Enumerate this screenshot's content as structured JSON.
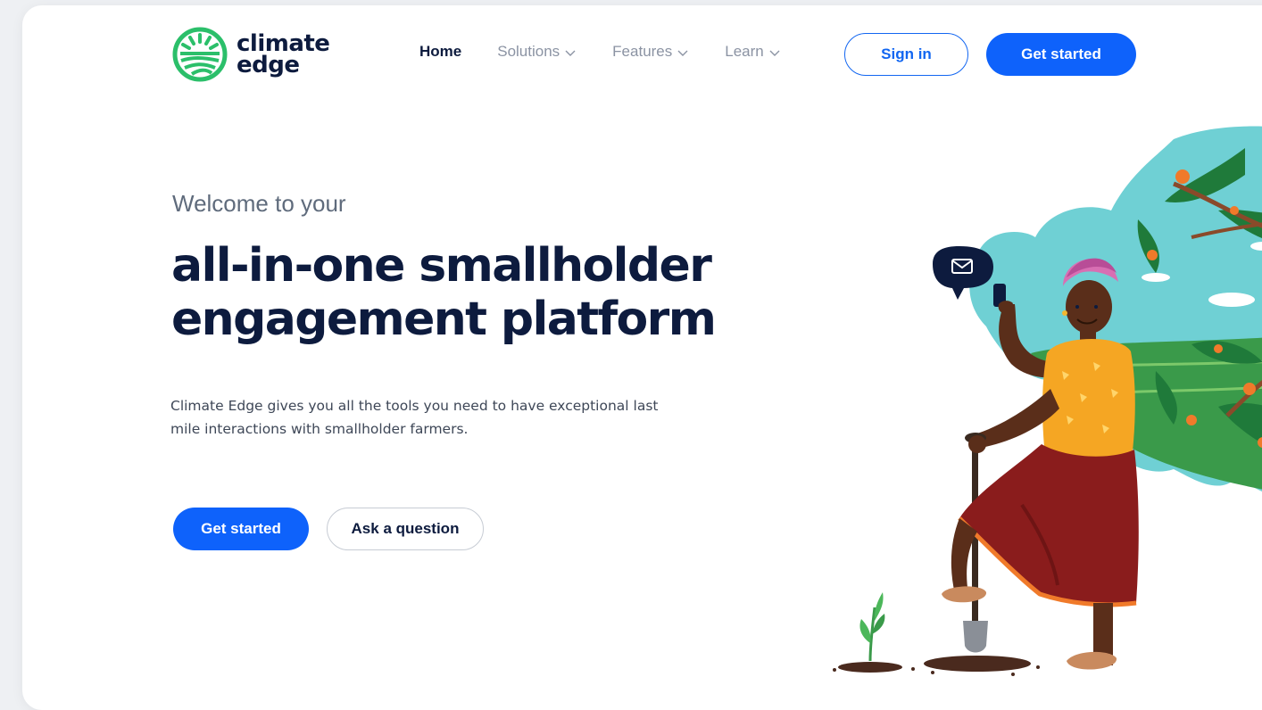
{
  "brand": {
    "name_line1": "climate",
    "name_line2": "edge",
    "colors": {
      "logo_green": "#2bbf6a",
      "navy": "#0d1b3e",
      "primary_blue": "#0e62fb"
    }
  },
  "nav": {
    "items": [
      {
        "label": "Home",
        "active": true,
        "dropdown": false
      },
      {
        "label": "Solutions",
        "active": false,
        "dropdown": true
      },
      {
        "label": "Features",
        "active": false,
        "dropdown": true
      },
      {
        "label": "Learn",
        "active": false,
        "dropdown": true
      }
    ],
    "sign_in_label": "Sign in",
    "get_started_label": "Get started"
  },
  "hero": {
    "eyebrow": "Welcome to your",
    "headline_line1": "all-in-one smallholder",
    "headline_line2": "engagement platform",
    "description": "Climate Edge gives you all the tools you need to have exceptional last mile interactions with smallholder farmers.",
    "primary_cta": "Get started",
    "secondary_cta": "Ask a question"
  },
  "illustration": {
    "subject": "farmer-with-phone-and-shovel",
    "icons": [
      "mail-icon",
      "phone-icon",
      "shovel-icon",
      "seedling-icon",
      "orange-tree"
    ]
  }
}
